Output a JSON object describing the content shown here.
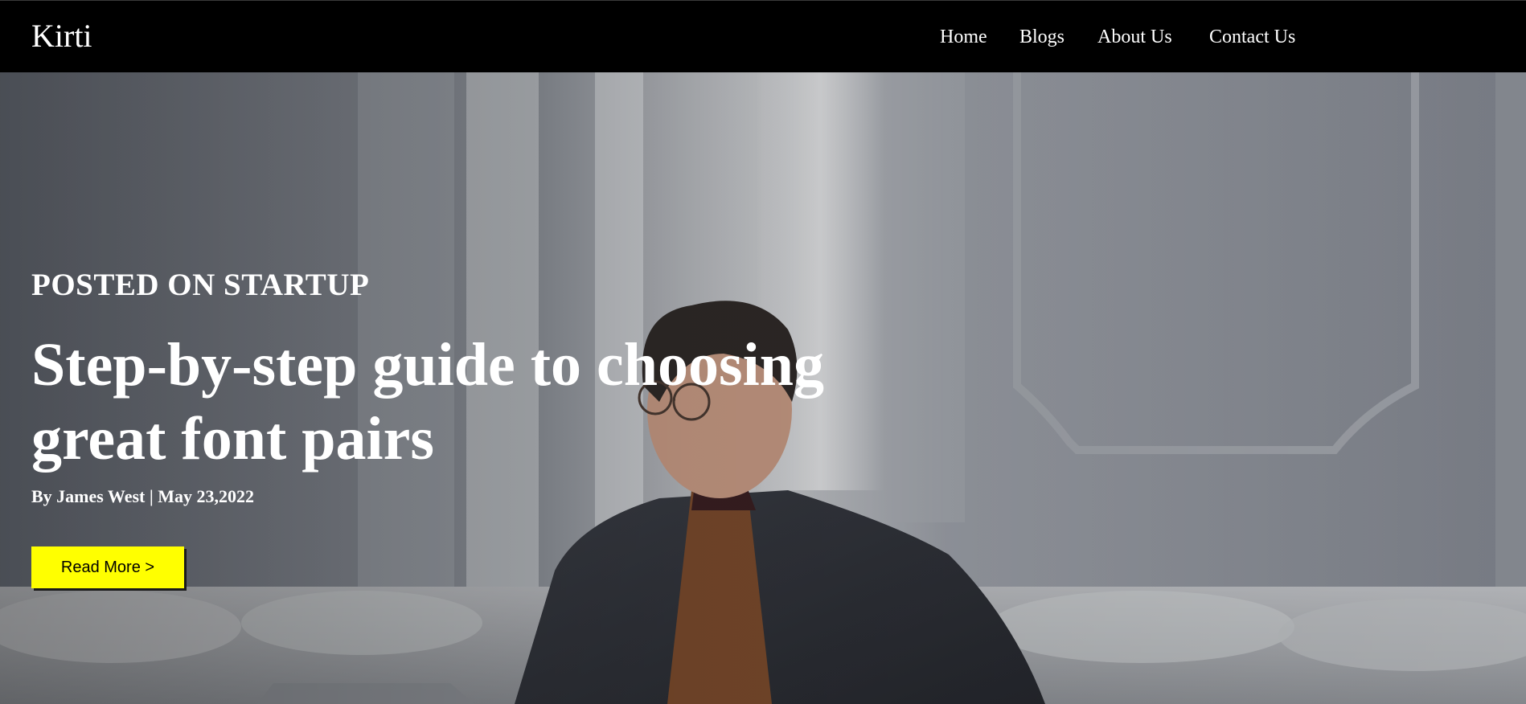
{
  "header": {
    "brand": "Kirti",
    "nav": [
      {
        "label": "Home"
      },
      {
        "label": "Blogs"
      },
      {
        "label": "About Us"
      },
      {
        "label": "Contact Us"
      }
    ]
  },
  "hero": {
    "category": "POSTED ON STARTUP",
    "title": "Step-by-step guide to choosing great font pairs",
    "byline": "By James West | May 23,2022",
    "cta_label": "Read More >",
    "cta_color": "#ffff00",
    "image_description_icon": "man-with-laptop-photo"
  }
}
